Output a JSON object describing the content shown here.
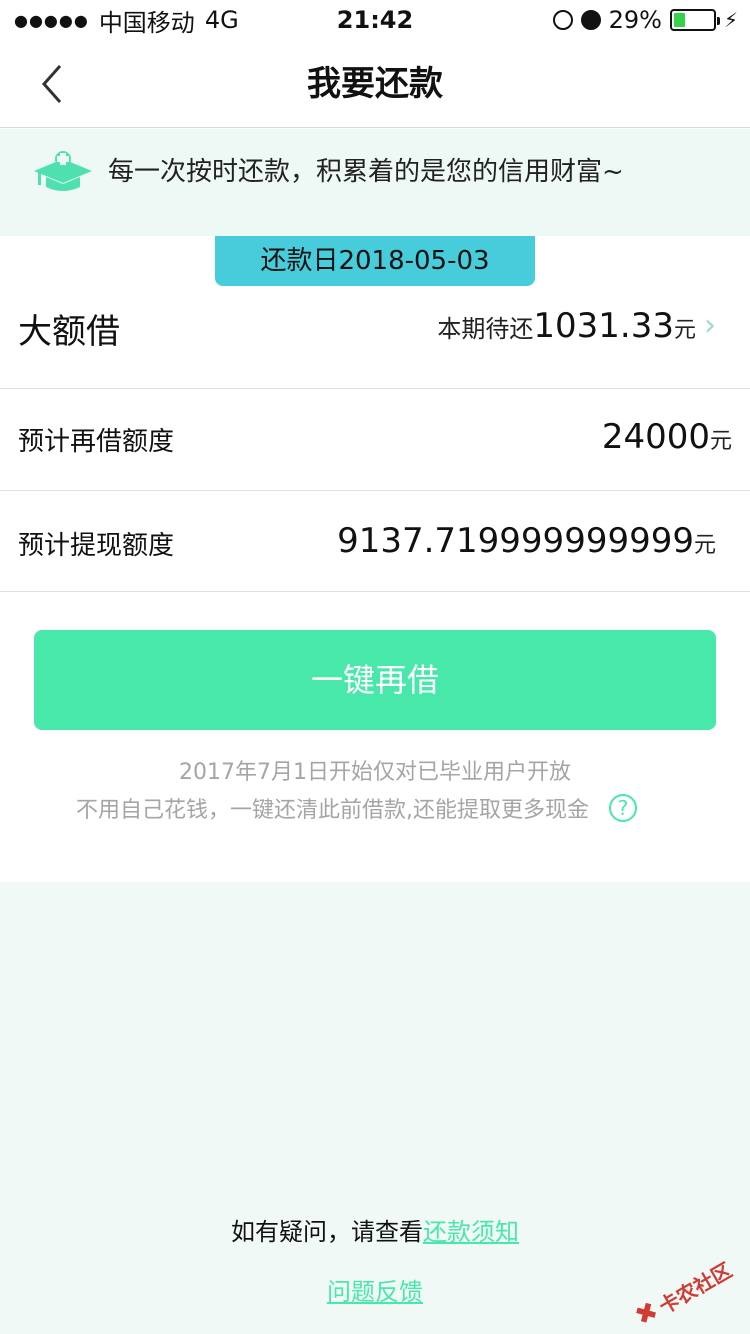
{
  "status_bar": {
    "signal": "●●●●●",
    "carrier": "中国移动",
    "network": "4G",
    "time": "21:42",
    "battery_percent": "29%",
    "battery_level": 0.29
  },
  "nav": {
    "title": "我要还款"
  },
  "banner": {
    "text": "每一次按时还款，积累着的是您的信用财富~"
  },
  "repayment": {
    "date_label": "还款日2018-05-03",
    "product": "大额借",
    "due_label": "本期待还",
    "due_amount": "1031.33",
    "unit": "元",
    "chevron": "›"
  },
  "limits": {
    "reborrow_label": "预计再借额度",
    "reborrow_amount": "24000",
    "withdraw_label": "预计提现额度",
    "withdraw_amount": "9137.719999999999",
    "unit": "元"
  },
  "cta": {
    "label": "一键再借"
  },
  "notes": {
    "line1": "2017年7月1日开始仅对已毕业用户开放",
    "line2": "不用自己花钱，一键还清此前借款,还能提取更多现金",
    "help_symbol": "?"
  },
  "footer": {
    "faq_prefix": "如有疑问，请查看",
    "faq_link": "还款须知",
    "feedback": "问题反馈"
  },
  "watermark": {
    "text": "卡农社区"
  },
  "colors": {
    "accent": "#48e8ab",
    "tag": "#47ccdc",
    "banner_bg": "#eef8f4"
  }
}
